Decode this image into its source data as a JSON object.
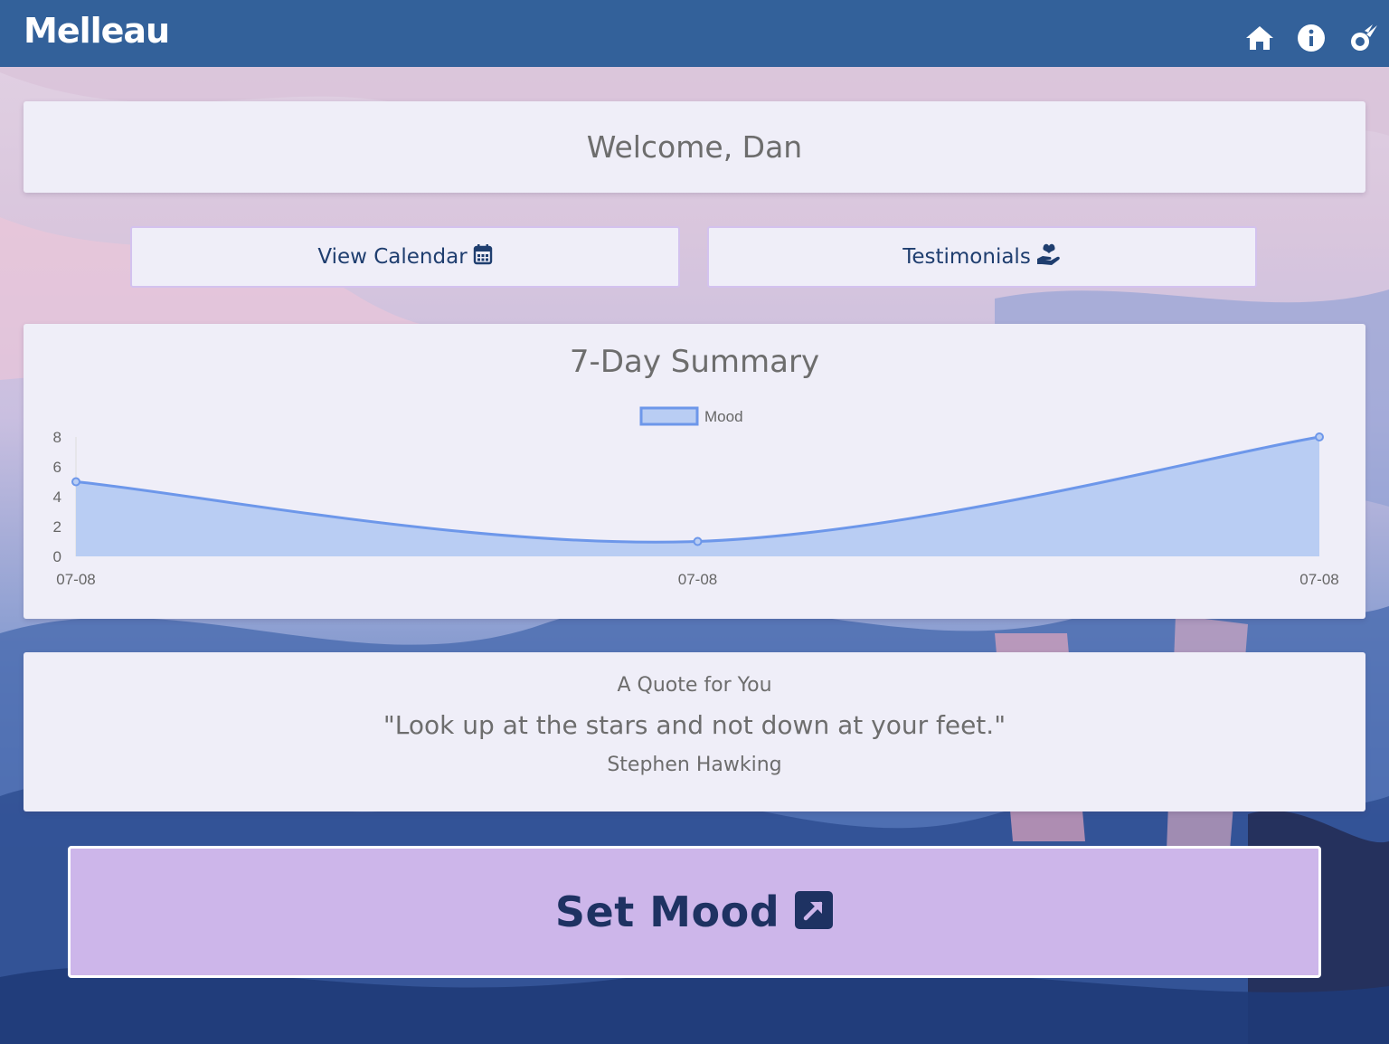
{
  "app": {
    "title": "Melleau",
    "nav": [
      {
        "icon": "home-icon"
      },
      {
        "icon": "info-icon"
      },
      {
        "icon": "comet-icon"
      }
    ]
  },
  "welcome": {
    "text": "Welcome, Dan"
  },
  "actions": {
    "calendar": {
      "label": "View Calendar",
      "icon": "calendar-icon"
    },
    "testimonials": {
      "label": "Testimonials",
      "icon": "hand-heart-icon"
    }
  },
  "summary": {
    "title": "7-Day Summary"
  },
  "chart_data": {
    "type": "area",
    "legend": [
      "Mood"
    ],
    "legend_position": "top-center",
    "x": [
      "07-08",
      "07-08",
      "07-08"
    ],
    "series": [
      {
        "name": "Mood",
        "values": [
          5,
          1,
          8
        ]
      }
    ],
    "yticks": [
      "0",
      "2",
      "4",
      "6",
      "8"
    ],
    "ylim": [
      0,
      8
    ],
    "grid": false,
    "colors": {
      "line": "#6d97ea",
      "fill": "#b9cdf3"
    }
  },
  "quote": {
    "heading": "A Quote for You",
    "text": "\"Look up at the stars and not down at your feet.\"",
    "author": "Stephen Hawking"
  },
  "cta": {
    "label": "Set Mood",
    "icon": "external-link-icon"
  },
  "colors": {
    "topbar": "#33619a",
    "card": "#efeef8",
    "accent": "#cdb6ea",
    "text_dark": "#1e3262"
  }
}
